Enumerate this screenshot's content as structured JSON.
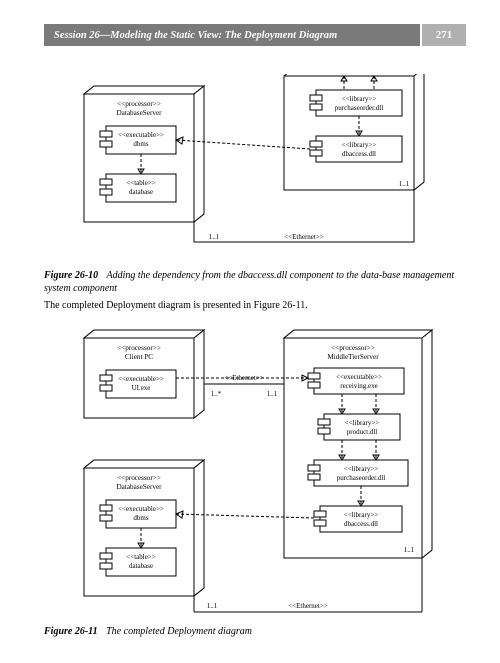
{
  "header": {
    "title": "Session 26—Modeling the Static View: The Deployment Diagram",
    "page": "271"
  },
  "fig10": {
    "label": "Figure 26-10",
    "caption": "Adding the dependency from the dbaccess.dll component to the data-base management system component"
  },
  "bodyText": "The completed Deployment diagram is presented in Figure 26-11.",
  "fig11": {
    "label": "Figure 26-11",
    "caption": "The completed Deployment diagram"
  },
  "labels": {
    "processor": "<<processor>>",
    "executable": "<<executable>>",
    "library": "<<library>>",
    "table": "<<table>>",
    "ethernet": "<<Ethernet>>",
    "databaseServer": "DatabaseServer",
    "dbms": "dbms",
    "database": "database",
    "purchaseorder": "purchaseorder.dll",
    "dbaccess": "dbaccess.dll",
    "clientPC": "Client PC",
    "uiexe": "UI.exe",
    "middleTier": "MiddleTierServer",
    "receiving": "receiving.exe",
    "product": "product.dll",
    "m1_1": "1..1",
    "m1_star": "1..*"
  }
}
